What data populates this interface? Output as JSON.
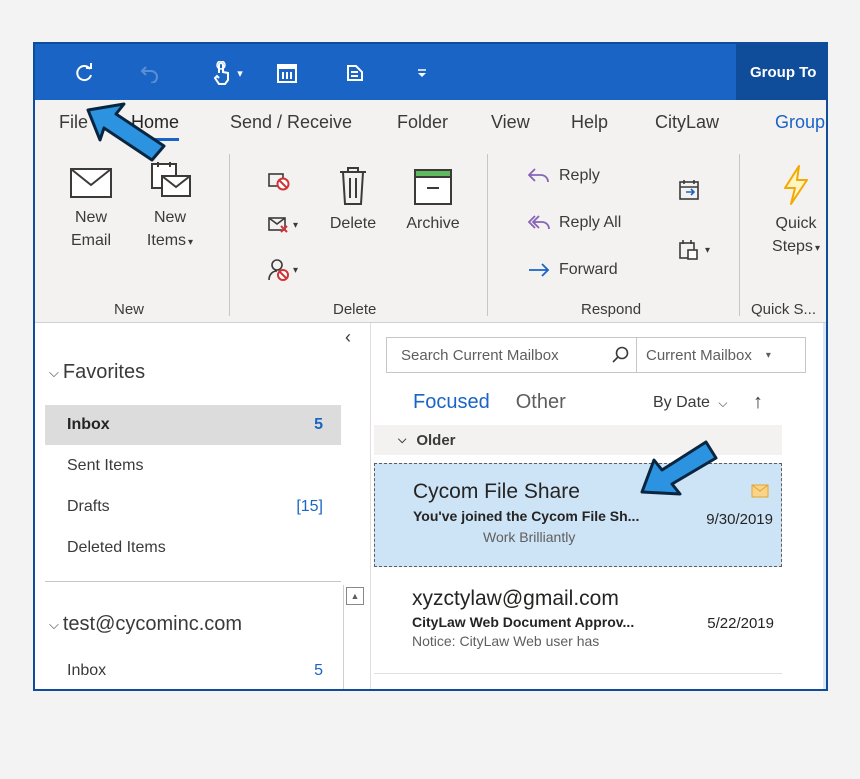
{
  "quick_access": {
    "icons": [
      "sync-icon",
      "undo-icon",
      "touch-mode-icon",
      "calendar-icon",
      "send-receive-icon",
      "customize-icon"
    ]
  },
  "title_bar": {
    "group_tab_label": "Group To"
  },
  "ribbon_tabs": [
    "File",
    "Home",
    "Send / Receive",
    "Folder",
    "View",
    "Help",
    "CityLaw",
    "Group"
  ],
  "ribbon": {
    "new_email": [
      "New",
      "Email"
    ],
    "new_items": [
      "New",
      "Items"
    ],
    "delete_label": "Delete",
    "archive_label": "Archive",
    "reply_label": "Reply",
    "reply_all_label": "Reply All",
    "forward_label": "Forward",
    "quick_steps": [
      "Quick",
      "Steps"
    ],
    "groups": {
      "new": "New",
      "delete": "Delete",
      "respond": "Respond",
      "quick_steps": "Quick S..."
    }
  },
  "folders": {
    "collapse_glyph": "‹",
    "favorites_header": "Favorites",
    "favorites": [
      {
        "name": "Inbox",
        "count": "5"
      },
      {
        "name": "Sent Items",
        "count": ""
      },
      {
        "name": "Drafts",
        "count": "[15]"
      },
      {
        "name": "Deleted Items",
        "count": ""
      }
    ],
    "account_header": "test@cycominc.com",
    "account_items": [
      {
        "name": "Inbox",
        "count": "5"
      }
    ]
  },
  "mail_list": {
    "search_placeholder": "Search Current Mailbox",
    "search_scope": "Current Mailbox",
    "tab_focused": "Focused",
    "tab_other": "Other",
    "sort_label": "By Date",
    "group_header": "Older",
    "messages": [
      {
        "from": "Cycom File Share",
        "subject": "You've joined the Cycom File Sh...",
        "preview": "Work Brilliantly",
        "date": "9/30/2019",
        "selected": true
      },
      {
        "from": "xyzctylaw@gmail.com",
        "subject": "CityLaw Web Document Approv...",
        "preview": "Notice: CityLaw Web user has",
        "date": "5/22/2019",
        "selected": false
      }
    ]
  },
  "colors": {
    "accent": "#1a64c6",
    "title_bar": "#1a64c6",
    "selected_message": "#cde3f6",
    "annotation_arrow": "#2c93e0"
  }
}
